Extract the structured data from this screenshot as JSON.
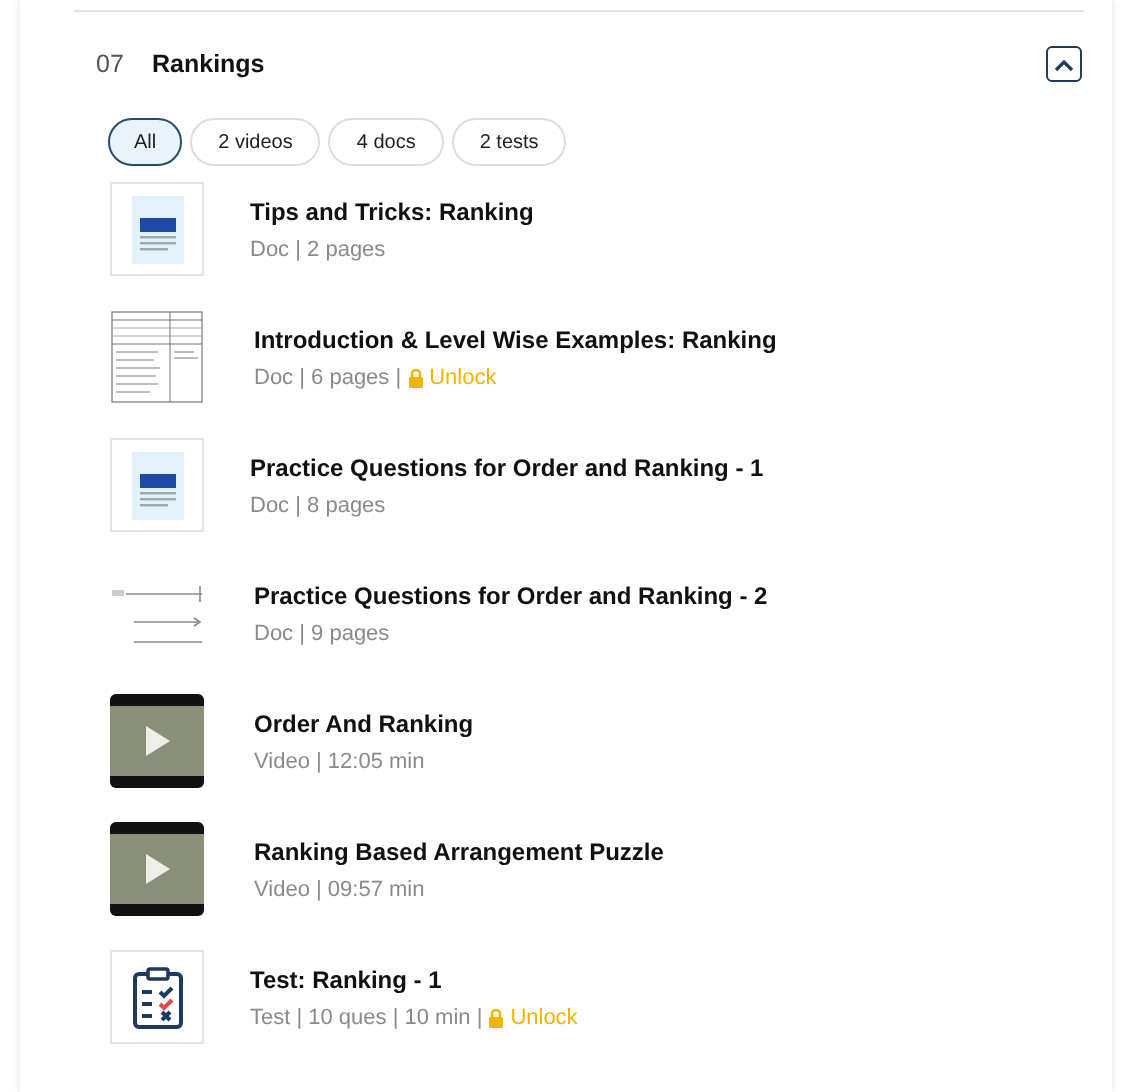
{
  "section": {
    "number": "07",
    "title": "Rankings",
    "expanded": true
  },
  "filters": [
    {
      "label": "All",
      "selected": true
    },
    {
      "label": "2 videos",
      "selected": false
    },
    {
      "label": "4 docs",
      "selected": false
    },
    {
      "label": "2 tests",
      "selected": false
    }
  ],
  "items": [
    {
      "kind": "doc-icon",
      "title": "Tips and Tricks: Ranking",
      "meta": "Doc | 2 pages",
      "locked": false
    },
    {
      "kind": "doc-scan",
      "title": "Introduction & Level Wise Examples: Ranking",
      "meta": "Doc | 6 pages |",
      "locked": true,
      "unlock": "Unlock"
    },
    {
      "kind": "doc-icon",
      "title": "Practice Questions for Order and Ranking - 1",
      "meta": "Doc | 8 pages",
      "locked": false
    },
    {
      "kind": "diagram",
      "title": "Practice Questions for Order and Ranking - 2",
      "meta": "Doc | 9 pages",
      "locked": false
    },
    {
      "kind": "video",
      "title": "Order And Ranking",
      "meta": "Video | 12:05 min",
      "locked": false
    },
    {
      "kind": "video",
      "title": "Ranking Based Arrangement Puzzle",
      "meta": "Video | 09:57 min",
      "locked": false
    },
    {
      "kind": "test",
      "title": "Test: Ranking - 1",
      "meta": "Test | 10 ques | 10 min |",
      "locked": true,
      "unlock": "Unlock"
    }
  ]
}
